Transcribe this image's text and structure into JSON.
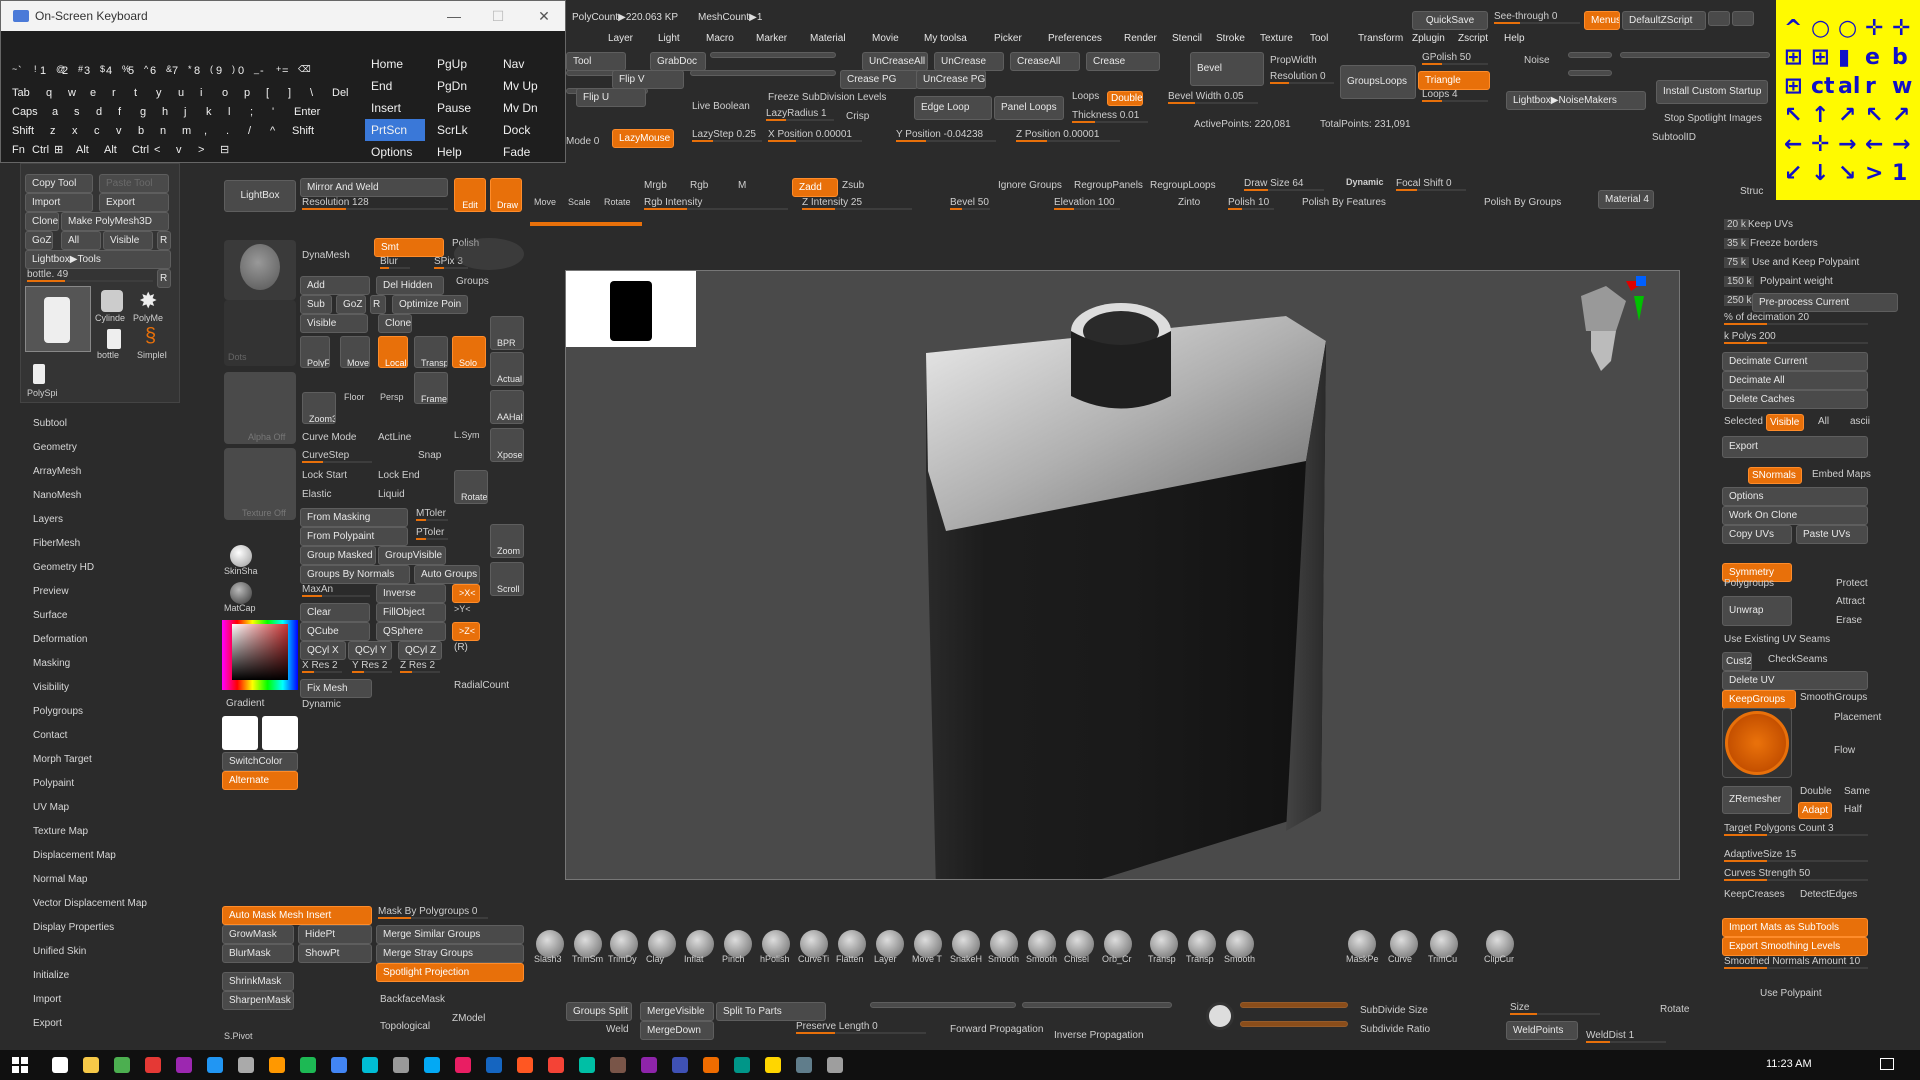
{
  "osk": {
    "title": "On-Screen Keyboard",
    "min": "—",
    "max": "☐",
    "close": "✕",
    "row1": [
      "~",
      "!",
      "@",
      "#",
      "$",
      "%",
      "^",
      "&",
      "*",
      "(",
      ")",
      "_",
      "+",
      "⌫"
    ],
    "row1b": [
      "`",
      "1",
      "2",
      "3",
      "4",
      "5",
      "6",
      "7",
      "8",
      "9",
      "0",
      "-",
      "="
    ],
    "row2": [
      "Tab",
      "q",
      "w",
      "e",
      "r",
      "t",
      "y",
      "u",
      "i",
      "o",
      "p",
      "[",
      "]",
      "\\",
      "Del"
    ],
    "row3": [
      "Caps",
      "a",
      "s",
      "d",
      "f",
      "g",
      "h",
      "j",
      "k",
      "l",
      ";",
      "'",
      "Enter"
    ],
    "row4": [
      "Shift",
      "z",
      "x",
      "c",
      "v",
      "b",
      "n",
      "m",
      ",",
      ".",
      "/",
      "^",
      "Shift"
    ],
    "row5": [
      "Fn",
      "Ctrl",
      "⊞",
      "Alt",
      "Alt",
      "Ctrl",
      "<",
      "v",
      ">",
      "⊟"
    ],
    "nav": [
      [
        "Home",
        "PgUp",
        "Nav"
      ],
      [
        "End",
        "PgDn",
        "Mv Up"
      ],
      [
        "Insert",
        "Pause",
        "Mv Dn"
      ],
      [
        "PrtScn",
        "ScrLk",
        "Dock"
      ],
      [
        "Options",
        "Help",
        "Fade"
      ]
    ]
  },
  "topinfo": {
    "polycount": "PolyCount▶220.063 KP",
    "meshcount": "MeshCount▶1",
    "quicksave": "QuickSave",
    "seethrough": "See-through  0",
    "menus": "Menus",
    "defaultzscript": "DefaultZScript"
  },
  "menu": [
    "Layer",
    "Light",
    "Macro",
    "Marker",
    "Material",
    "Movie",
    "My toolsa",
    "Picker",
    "Preferences",
    "Render",
    "Stencil",
    "Stroke",
    "Texture",
    "Tool",
    "Transform",
    "Zplugin",
    "Zscript",
    "Help"
  ],
  "toprow": {
    "tool": "Tool",
    "grabdoc": "GrabDoc",
    "uncreaseall": "UnCreaseAll",
    "uncrease": "UnCrease",
    "creaseall": "CreaseAll",
    "crease": "Crease",
    "flipv": "Flip V",
    "creasepg": "Crease PG",
    "uncreasepg": "UnCrease PG",
    "flipu": "Flip U",
    "freeze": "Freeze SubDivision Levels",
    "liveboolean": "Live Boolean",
    "lazyradius": "LazyRadius 1",
    "crisp": "Crisp",
    "edgeloop": "Edge Loop",
    "panelloops": "Panel Loops",
    "loops": "Loops",
    "double": "Double",
    "thickness": "Thickness 0.01",
    "mode": "Mode 0",
    "lazymouse": "LazyMouse",
    "lazystep": "LazyStep 0.25",
    "xpos": "X Position 0.00001",
    "ypos": "Y Position -0.04238",
    "zpos": "Z Position 0.00001",
    "bevel": "Bevel",
    "propwidth": "PropWidth",
    "resolution": "Resolution 0",
    "groupsloops": "GroupsLoops",
    "gpolish": "GPolish 50",
    "triangle": "Triangle",
    "loops4": "Loops 4",
    "bevelwidth": "Bevel Width 0.05",
    "activepoints": "ActivePoints: 220,081",
    "totalpoints": "TotalPoints: 231,091",
    "noise": "Noise",
    "lightboxnoise": "Lightbox▶NoiseMakers",
    "installcustom": "Install Custom Startup",
    "stopspot": "Stop Spotlight Images",
    "subtoolid": "SubtoolID"
  },
  "yellow": [
    [
      "^",
      "○",
      "○",
      "✛",
      "✛"
    ],
    [
      "⊞",
      "⊞",
      "▮",
      "e",
      "b"
    ],
    [
      "⊞",
      "ct",
      "al",
      "r",
      "w"
    ],
    [
      "↖",
      "↑",
      "↗",
      "↖",
      "↗"
    ],
    [
      "←",
      "✛",
      "→",
      "←",
      "→"
    ],
    [
      "↙",
      "↓",
      "↘",
      ">",
      "1"
    ]
  ],
  "tools": {
    "copytool": "Copy Tool",
    "pastetool": "Paste Tool",
    "import": "Import",
    "export": "Export",
    "clone": "Clone",
    "makepoly": "Make PolyMesh3D",
    "goz": "GoZ",
    "all": "All",
    "visible": "Visible",
    "r": "R",
    "lightboxtools": "Lightbox▶Tools",
    "bottle": "bottle. 49",
    "thumbs": [
      "bottle",
      "Cylinde",
      "PolyMe",
      "bottle",
      "SimpleI",
      "PolySpi"
    ]
  },
  "leftmenu": [
    "Subtool",
    "Geometry",
    "ArrayMesh",
    "NanoMesh",
    "Layers",
    "FiberMesh",
    "Geometry HD",
    "Preview",
    "Surface",
    "Deformation",
    "Masking",
    "Visibility",
    "Polygroups",
    "Contact",
    "Morph Target",
    "Polypaint",
    "UV Map",
    "Texture Map",
    "Displacement Map",
    "Normal Map",
    "Vector Displacement Map",
    "Display Properties",
    "Unified Skin",
    "Initialize",
    "Import",
    "Export"
  ],
  "shelf": {
    "lightbox": "LightBox",
    "mirror": "Mirror And Weld",
    "resolution128": "Resolution 128",
    "edit": "Edit",
    "draw": "Draw",
    "move": "Move",
    "scale": "Scale",
    "rotate": "Rotate",
    "mrgb": "Mrgb",
    "rgb": "Rgb",
    "m": "M",
    "zadd": "Zadd",
    "zsub": "Zsub",
    "zint": "Z Intensity 25",
    "rgbint": "Rgb Intensity",
    "bevel50": "Bevel 50",
    "ignoregroups": "Ignore Groups",
    "regrouppanels": "RegroupPanels",
    "regrouploops": "RegroupLoops",
    "elevation": "Elevation 100",
    "zinto": "Zinto",
    "drawsize": "Draw Size 64",
    "dynamic": "Dynamic",
    "focal": "Focal Shift 0",
    "polish10": "Polish 10",
    "polishfeat": "Polish By Features",
    "polishgroups": "Polish By Groups",
    "material4": "Material 4"
  },
  "mid": {
    "dynamesh": "DynaMesh",
    "smt": "Smt",
    "polish": "Polish",
    "blur": "Blur",
    "spix": "SPix 3",
    "groups": "Groups",
    "add": "Add",
    "delhidden": "Del Hidden",
    "sub": "Sub",
    "goz": "GoZ",
    "r": "R",
    "optimize": "Optimize Poin",
    "visible": "Visible",
    "clone": "Clone",
    "curvemode": "Curve Mode",
    "actline": "ActLine",
    "curvestep": "CurveStep",
    "snap": "Snap",
    "lockstart": "Lock Start",
    "lockend": "Lock End",
    "elastic": "Elastic",
    "liquid": "Liquid",
    "frommasking": "From Masking",
    "mtoler": "MToler",
    "frompolypaint": "From Polypaint",
    "ptoler": "PToler",
    "groupmasked": "Group Masked",
    "groupvisible": "GroupVisible",
    "groupsnormals": "Groups By Normals",
    "autogroups": "Auto Groups",
    "maxan": "MaxAn",
    "inverse": "Inverse",
    "clear": "Clear",
    "fillobject": "FillObject",
    "qcube": "QCube",
    "qsphere": "QSphere",
    "qcylx": "QCyl X",
    "qcyly": "QCyl Y",
    "qcylz": "QCyl Z",
    "r2": "(R)",
    "xres": "X Res 2",
    "yres": "Y Res 2",
    "zres": "Z Res 2",
    "fixmesh": "Fix Mesh",
    "radialcount": "RadialCount",
    "dynamic2": "Dynamic",
    "automaskmesh": "Auto Mask Mesh Insert",
    "maskbypoly": "Mask By Polygroups 0",
    "growmask": "GrowMask",
    "hidept": "HidePt",
    "mergesimilar": "Merge Similar Groups",
    "blurmask": "BlurMask",
    "showpt": "ShowPt",
    "mergestray": "Merge Stray Groups",
    "spotlightproj": "Spotlight Projection",
    "shrinkmask": "ShrinkMask",
    "sharpenmask": "SharpenMask",
    "backface": "BackfaceMask",
    "topological": "Topological",
    "zmodel": "ZModel",
    "spivot": "S.Pivot",
    "dots": "Dots",
    "alphaoff": "Alpha Off",
    "textureoff": "Texture Off",
    "skinsha": "SkinSha",
    "matcap": "MatCap",
    "gradient": "Gradient",
    "switchcolor": "SwitchColor",
    "alternate": "Alternate"
  },
  "iconcol": {
    "bpr": "BPR",
    "actual": "Actual",
    "aahalf": "AAHalf",
    "xpose": "Xpose",
    "zoom": "Zoom",
    "scroll": "Scroll",
    "lsym": "L.Sym",
    "rotate": "Rotate",
    "polyf": "PolyF",
    "move": "Move",
    "local": "Local",
    "transp": "Transp",
    "solo": "Solo",
    "floor": "Floor",
    "persp": "Persp",
    "frame": "Frame",
    "zoom3d": "Zoom3D"
  },
  "right": {
    "keepuvs": "Keep UVs",
    "freezeborders": "Freeze borders",
    "usekeep": "Use and Keep Polypaint",
    "polypaintweight": "Polypaint weight",
    "preprocess": "Pre-process Current",
    "pctdecimation": "% of decimation 20",
    "kpolys": "k Polys 200",
    "decimatecurrent": "Decimate Current",
    "decimateall": "Decimate All",
    "deletecaches": "Delete Caches",
    "selected": "Selected",
    "visible": "Visible",
    "all": "All",
    "ascii": "ascii",
    "export": "Export",
    "snormals": "SNormals",
    "embedmaps": "Embed Maps",
    "options": "Options",
    "workonclone": "Work On Clone",
    "copyuvs": "Copy UVs",
    "pasteuvs": "Paste UVs",
    "symmetry": "Symmetry",
    "protect": "Protect",
    "polygroups": "Polygroups",
    "attract": "Attract",
    "erase": "Erase",
    "unwrap": "Unwrap",
    "useexisting": "Use Existing UV Seams",
    "cust2": "Cust2",
    "checkseams": "CheckSeams",
    "deleteuv": "Delete UV",
    "keepgroups": "KeepGroups",
    "smoothgroups": "SmoothGroups",
    "placement": "Placement",
    "flow": "Flow",
    "zremesher": "ZRemesher",
    "double": "Double",
    "same": "Same",
    "adapt": "Adapt",
    "half": "Half",
    "targetpoly": "Target Polygons Count 3",
    "adaptivesize": "AdaptiveSize 15",
    "curvesstrength": "Curves Strength 50",
    "keepcreases": "KeepCreases",
    "detectedges": "DetectEdges",
    "importmats": "Import Mats as SubTools",
    "exportsmoothing": "Export Smoothing Levels",
    "smoothednormals": "Smoothed Normals Amount 10",
    "usepolypaint": "Use Polypaint",
    "rotate": "Rotate",
    "size": "Size",
    "weldpoints": "WeldPoints",
    "weldist": "WeldDist 1",
    "structure": "Struc"
  },
  "nums": [
    "20 k",
    "35 k",
    "75 k",
    "150 k",
    "250 k"
  ],
  "brushes": [
    "Slash3",
    "TrimSm",
    "TrimDy",
    "Clay",
    "Inflat",
    "Pinch",
    "hPolish",
    "CurveTi",
    "Flatten",
    "Layer",
    "Move T",
    "SnakeH",
    "Smooth",
    "Smooth",
    "Chisel",
    "Orb_Cr",
    "Transp",
    "Transp",
    "Smooth",
    "MaskPe",
    "Curve",
    "TrimCu",
    "ClipCur"
  ],
  "bottom": {
    "groupssplit": "Groups Split",
    "mergevisible": "MergeVisible",
    "splittoparts": "Split To Parts",
    "weld": "Weld",
    "mergedown": "MergeDown",
    "preservelength": "Preserve Length 0",
    "forwardprop": "Forward Propagation",
    "inverseprop": "Inverse Propagation",
    "subdivsize": "SubDivide Size",
    "subdivratio": "Subdivide Ratio"
  },
  "taskbar": {
    "time": "11:23 AM"
  },
  "colors": {
    "orange": "#e8700a",
    "yellow": "#fffa00",
    "bg": "#2b2b2b"
  }
}
